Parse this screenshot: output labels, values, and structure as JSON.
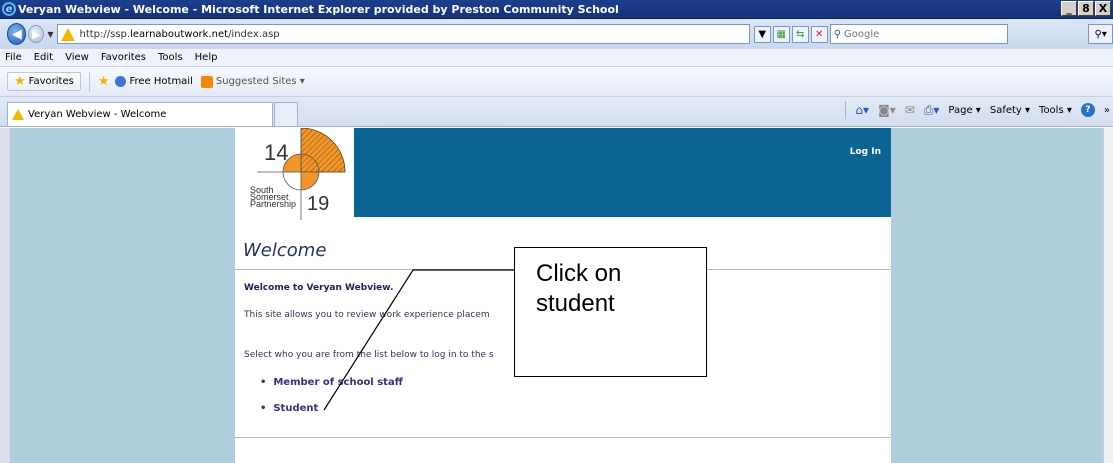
{
  "window": {
    "title": "Veryan Webview - Welcome - Microsoft Internet Explorer provided by Preston Community School",
    "controls": {
      "minimize": "_",
      "maximize": "8",
      "close": "X"
    }
  },
  "address_bar": {
    "url_prefix": "http://ssp.",
    "url_host": "learnaboutwork.net",
    "url_suffix": "/index.asp",
    "search_placeholder": "Google"
  },
  "menu": [
    "File",
    "Edit",
    "View",
    "Favorites",
    "Tools",
    "Help"
  ],
  "favorites_bar": {
    "favorites_label": "Favorites",
    "items": [
      "Free Hotmail",
      "Suggested Sites ▾"
    ]
  },
  "tab": {
    "title": "Veryan Webview - Welcome"
  },
  "command_bar": {
    "page": "Page ▾",
    "safety": "Safety ▾",
    "tools": "Tools ▾",
    "more": "»"
  },
  "page": {
    "logo": {
      "top": "14",
      "bottom": "19",
      "org": [
        "South",
        "Somerset",
        "Partnership"
      ]
    },
    "login_link": "Log In",
    "heading": "Welcome",
    "greeting": "Welcome to Veryan Webview.",
    "intro": "This site allows you to review work experience placem",
    "select_prompt": "Select who you are from the list below to log in to the s",
    "options": [
      "Member of school staff",
      "Student"
    ]
  },
  "callout": {
    "text": "Click on student"
  },
  "colors": {
    "header_bar": "#0a6592",
    "page_bg": "#aecddd",
    "logo_orange": "#f0962a"
  }
}
